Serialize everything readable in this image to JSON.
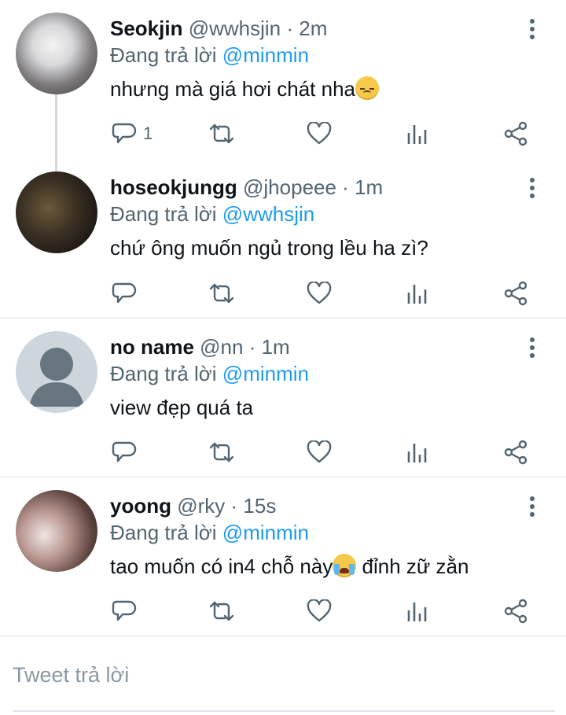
{
  "tweets": [
    {
      "name": "Seokjin",
      "handle": "@wwhsjin",
      "time": "2m",
      "reply_prefix": "Đang trả lời",
      "reply_to": "@minmin",
      "text": "nhưng mà giá hơi chát nha",
      "emoji": "pensive-face",
      "reply_count": "1"
    },
    {
      "name": "hoseokjungg",
      "handle": "@jhopeee",
      "time": "1m",
      "reply_prefix": "Đang trả lời",
      "reply_to": "@wwhsjin",
      "text": "chứ ông muốn ngủ trong lều ha zì?",
      "reply_count": ""
    },
    {
      "name": "no name",
      "handle": "@nn",
      "time": "1m",
      "reply_prefix": "Đang trả lời",
      "reply_to": "@minmin",
      "text": "view đẹp quá ta",
      "reply_count": ""
    },
    {
      "name": "yoong",
      "handle": "@rky",
      "time": "15s",
      "reply_prefix": "Đang trả lời",
      "reply_to": "@minmin",
      "text_before": "tao muốn có in4 chỗ này",
      "emoji": "loudly-crying-face",
      "text_after": " đỉnh zữ zằn",
      "reply_count": ""
    }
  ],
  "separator": " · ",
  "compose": {
    "placeholder": "Tweet trả lời"
  },
  "colors": {
    "link": "#1d9bf0",
    "secondary_text": "#536471",
    "divider": "#dfe4e8"
  }
}
